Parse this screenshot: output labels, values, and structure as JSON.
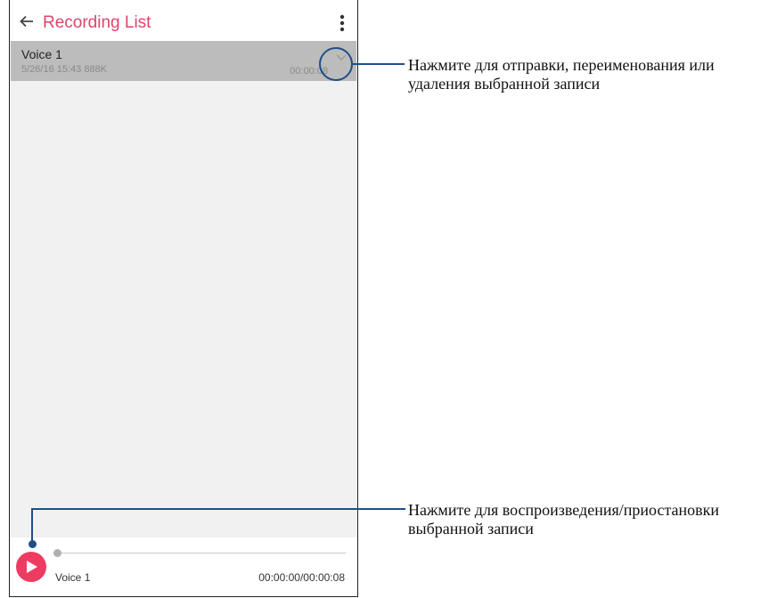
{
  "header": {
    "title": "Recording List"
  },
  "recordings": [
    {
      "name": "Voice 1",
      "meta": "5/26/16 15:43  888K",
      "duration": "00:00:08"
    }
  ],
  "player": {
    "name": "Voice 1",
    "time": "00:00:00/00:00:08",
    "progress": 0
  },
  "annotations": [
    {
      "text": "Нажмите для отправки, переименования или удаления выбранной записи"
    },
    {
      "text": "Нажмите для воспроизведения/приостановки выбранной записи"
    }
  ],
  "colors": {
    "accent": "#e0446b",
    "play": "#ed3b62",
    "callout": "#1d4f86"
  },
  "icons": [
    "back-arrow-icon",
    "more-vert-icon",
    "chevron-down-icon",
    "play-icon"
  ]
}
